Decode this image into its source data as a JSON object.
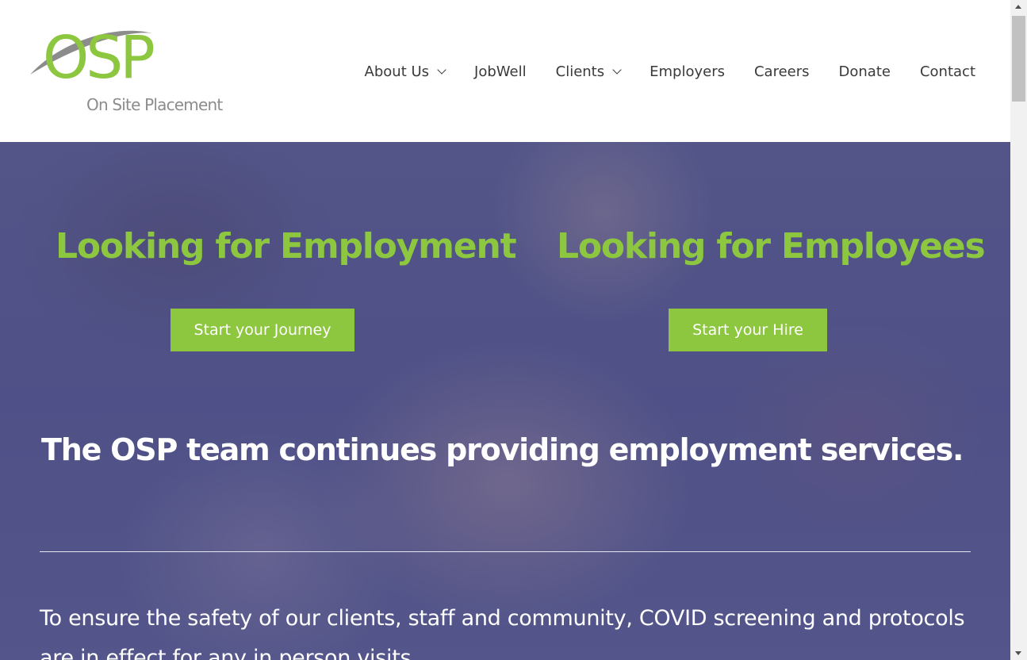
{
  "logo": {
    "mark": "OSP",
    "subtitle": "On Site Placement",
    "icon": "osp-swoosh-logo"
  },
  "nav": {
    "items": [
      {
        "label": "About Us",
        "has_dropdown": true
      },
      {
        "label": "JobWell",
        "has_dropdown": false
      },
      {
        "label": "Clients",
        "has_dropdown": true
      },
      {
        "label": "Employers",
        "has_dropdown": false
      },
      {
        "label": "Careers",
        "has_dropdown": false
      },
      {
        "label": "Donate",
        "has_dropdown": false
      },
      {
        "label": "Contact",
        "has_dropdown": false
      }
    ]
  },
  "hero": {
    "employment_heading": "Looking for Employment",
    "employees_heading": "Looking for Employees",
    "journey_button": "Start your Journey",
    "hire_button": "Start your Hire",
    "tagline": "The OSP team continues providing employment services.",
    "notice": "To ensure the safety of our clients, staff and community, COVID screening and protocols are in effect for any in person visits."
  },
  "colors": {
    "brand_green": "#8dc63f",
    "logo_gray": "#8c8c8c",
    "nav_text": "#3a3a3a",
    "hero_overlay": "#4e508c"
  }
}
